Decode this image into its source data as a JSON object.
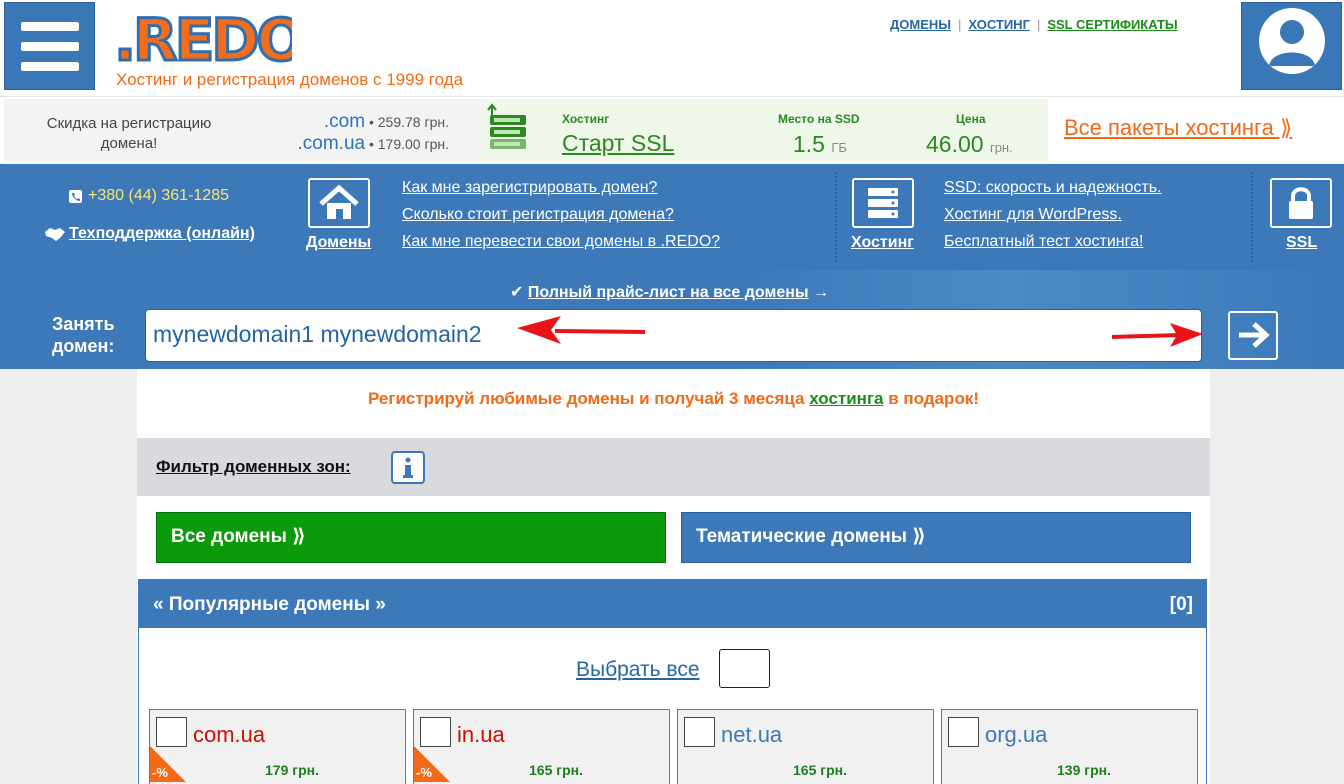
{
  "header": {
    "logo_text": ".REDO",
    "tagline": "Хостинг и регистрация доменов с 1999 года",
    "nav": [
      {
        "label": "ДОМЕНЫ"
      },
      {
        "label": "ХОСТИНГ"
      },
      {
        "label": "SSL СЕРТИФИКАТЫ"
      }
    ],
    "menu_icon": "hamburger-icon",
    "user_icon": "user-icon"
  },
  "promo": {
    "discount_text": "Скидка на регистрацию домена!",
    "prices": [
      {
        "zone": ".com",
        "price": "• 259.78 грн."
      },
      {
        "zone": ".com.ua",
        "price": "• 179.00 грн."
      }
    ],
    "hosting_label": "Хостинг",
    "hosting_plan": "Старт SSL",
    "ssd_label": "Место на SSD",
    "ssd_value": "1.5",
    "ssd_unit": "ГБ",
    "price_label": "Цена",
    "price_value": "46.00",
    "price_unit": "грн.",
    "all_packages": "Все пакеты хостинга ⟫",
    "server_icon": "server-icon"
  },
  "bluenav": {
    "phone": "+380 (44) 361-1285",
    "support": "Техподдержка (онлайн)",
    "domains_label": "Домены",
    "domain_links": [
      "Как мне зарегистрировать домен?",
      "Сколько стоит регистрация домена?",
      "Как мне перевести свои домены в .REDO?"
    ],
    "hosting_label": "Хостинг",
    "hosting_links": [
      "SSD: скорость и надежность.",
      "Хостинг для WordPress.",
      "Бесплатный тест хостинга!"
    ],
    "ssl_label": "SSL"
  },
  "search": {
    "pricelist_link": "Полный прайс-лист на все домены",
    "occupy_label_1": "Занять",
    "occupy_label_2": "домен:",
    "query": "mynewdomain1 mynewdomain2"
  },
  "main": {
    "gift_before": "Регистрируй любимые домены и получай 3 месяца ",
    "gift_link": "хостинга",
    "gift_after": " в подарок!",
    "filter_label": "Фильтр доменных зон:",
    "tab_all": "Все домены ⟫",
    "tab_thematic": "Тематические домены ⟫",
    "popular_title": "« Популярные домены »",
    "popular_count": "[0]",
    "select_all": "Выбрать все",
    "domains": [
      {
        "zone": "com.ua",
        "price": "179 грн.",
        "discount": "-%",
        "color": "#cc1100"
      },
      {
        "zone": "in.ua",
        "price": "165 грн.",
        "discount": "-%",
        "color": "#cc1100"
      },
      {
        "zone": "net.ua",
        "price": "165 грн.",
        "discount": "",
        "color": "#3d79b9"
      },
      {
        "zone": "org.ua",
        "price": "139 грн.",
        "discount": "",
        "color": "#3d79b9"
      }
    ]
  }
}
